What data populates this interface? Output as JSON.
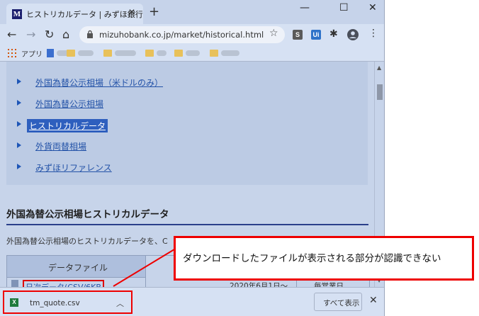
{
  "browser": {
    "tab_title": "ヒストリカルデータ | みずほ銀行",
    "favicon_letter": "M",
    "tab_close": "✕",
    "new_tab": "+",
    "window_controls": {
      "minimize": "—",
      "maximize": "☐",
      "close": "✕"
    },
    "url": "mizuhobank.co.jp/market/historical.html",
    "extensions": [
      {
        "label": "S",
        "color": "#5a5a5a"
      },
      {
        "label": "Ui",
        "color": "#2f73c9"
      }
    ]
  },
  "bookmarks": {
    "apps_label": "アプリ"
  },
  "nav_items": [
    {
      "label": "外国為替公示相場（米ドルのみ）",
      "selected": false
    },
    {
      "label": "外国為替公示相場",
      "selected": false
    },
    {
      "label": "ヒストリカルデータ",
      "selected": true
    },
    {
      "label": "外貨両替相場",
      "selected": false
    },
    {
      "label": "みずほリファレンス",
      "selected": false
    }
  ],
  "main": {
    "heading": "外国為替公示相場ヒストリカルデータ",
    "intro": "外国為替公示相場のヒストリカルデータを、C",
    "table": {
      "header_file": "データファイル",
      "row_link": "日次データ(CSV/6KB",
      "row_date": "2020年6月1日～",
      "row_update": "毎営業日"
    }
  },
  "download_bar": {
    "file_name": "tm_quote.csv",
    "file_icon": "X",
    "show_all": "すべて表示",
    "close": "✕"
  },
  "annotation": {
    "text": "ダウンロードしたファイルが表示される部分が認識できない",
    "color": "#e00000"
  }
}
